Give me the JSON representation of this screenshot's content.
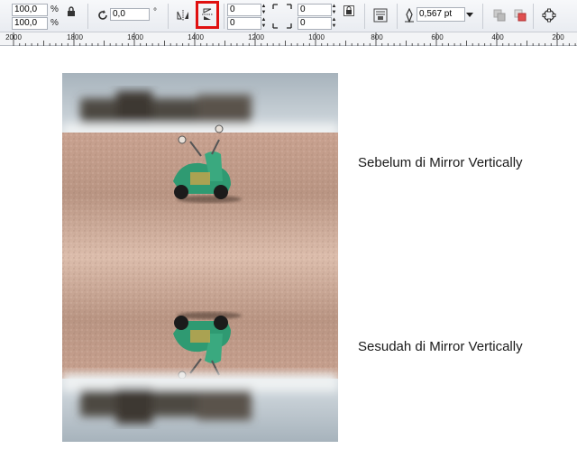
{
  "propbar": {
    "scale_x": "100,0",
    "scale_y": "100,0",
    "percent_sign": "%",
    "rotation": "0,0",
    "degree_sign": "°",
    "offset_top": "0",
    "offset_bottom": "0",
    "corner_top": "0",
    "corner_bottom": "0",
    "outline_width": "0,567 pt"
  },
  "ruler": {
    "labels": [
      "2000",
      "1800",
      "1600",
      "1400",
      "1200",
      "1000",
      "800",
      "600",
      "400",
      "200"
    ]
  },
  "canvas": {
    "caption_before": "Sebelum di Mirror Vertically",
    "caption_after": "Sesudah di Mirror Vertically"
  },
  "colors": {
    "highlight": "#e01010",
    "scooter": "#2f9a72",
    "sand": "#d9b7a6"
  },
  "icons": [
    "lock-icon",
    "rotate-icon",
    "mirror-horizontal-icon",
    "mirror-vertical-icon",
    "lock-ratio-icon",
    "wrap-text-icon",
    "pen-icon",
    "dropdown-arrow-icon",
    "to-front-icon",
    "to-back-icon",
    "convert-to-curves-icon"
  ]
}
